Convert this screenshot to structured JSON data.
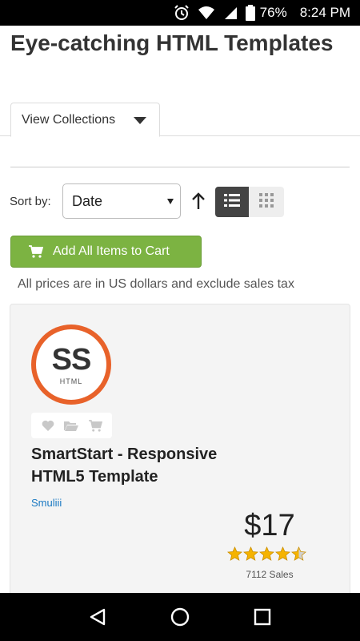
{
  "status_bar": {
    "battery_percent": "76%",
    "time": "8:24 PM",
    "icons": [
      "alarm-icon",
      "wifi-icon",
      "signal-icon",
      "battery-icon"
    ]
  },
  "page": {
    "title": "Eye-catching HTML Templates"
  },
  "tabs": {
    "view_collections_label": "View Collections"
  },
  "sort": {
    "label": "Sort by:",
    "selected": "Date"
  },
  "cart": {
    "button_label": "Add All Items to Cart"
  },
  "notice": {
    "text": "All prices are in US dollars and exclude sales tax"
  },
  "item": {
    "logo_text": "SS",
    "logo_subtext": "HTML",
    "title": "SmartStart - Responsive HTML5 Template",
    "author": "Smuliii",
    "price": "$17",
    "rating": 4.5,
    "sales": "7112 Sales"
  },
  "colors": {
    "accent_green": "#7cb342",
    "logo_orange": "#e8622a",
    "author_link": "#1a79c2",
    "star_gold": "#f5b301"
  }
}
